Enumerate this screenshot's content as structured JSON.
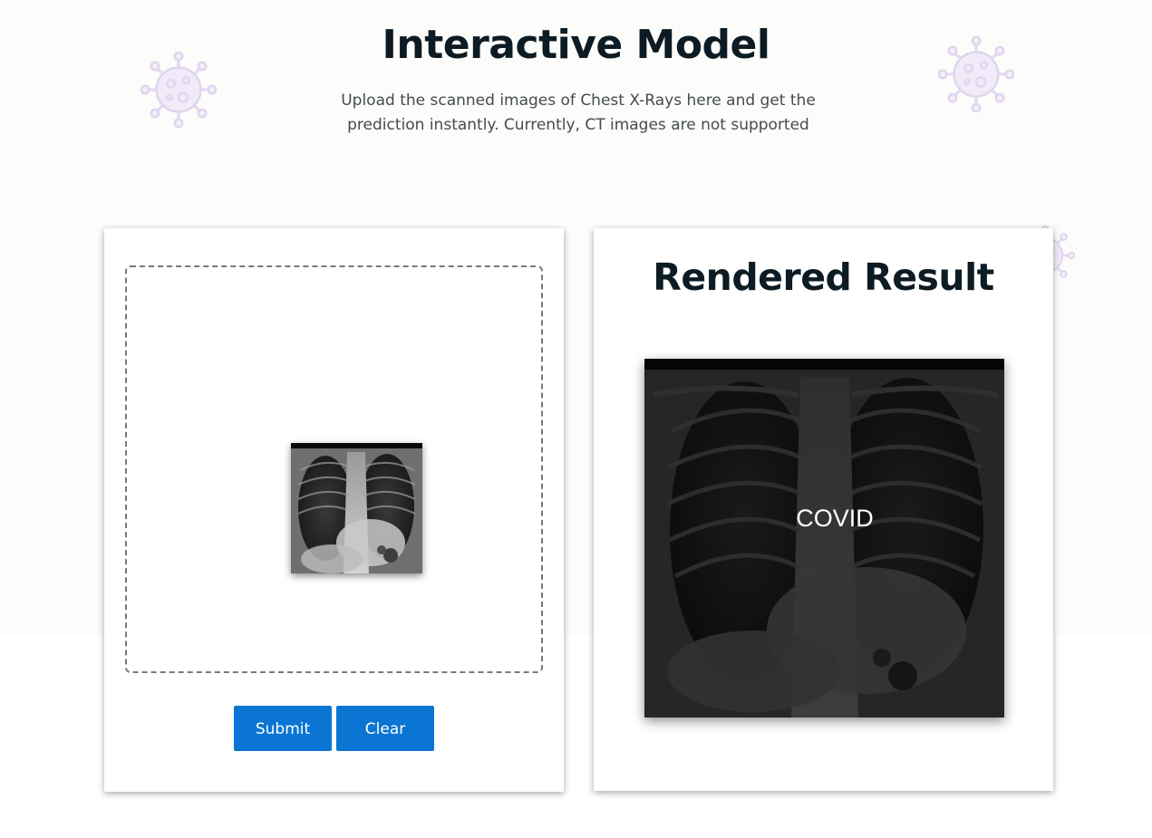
{
  "header": {
    "title": "Interactive Model",
    "subtitle": "Upload the scanned images of Chest X-Rays here and get the prediction instantly. Currently, CT images are not supported"
  },
  "upload_card": {
    "thumbnail_icon": "chest-xray-image",
    "submit_label": "Submit",
    "clear_label": "Clear"
  },
  "result_card": {
    "title": "Rendered Result",
    "image_icon": "chest-xray-image",
    "prediction": "COVID"
  },
  "decorations": {
    "icon": "virus-icon",
    "color": "#d9cdea"
  },
  "colors": {
    "accent": "#0a75d2",
    "heading": "#0d1b24",
    "body_text": "#444b50"
  }
}
